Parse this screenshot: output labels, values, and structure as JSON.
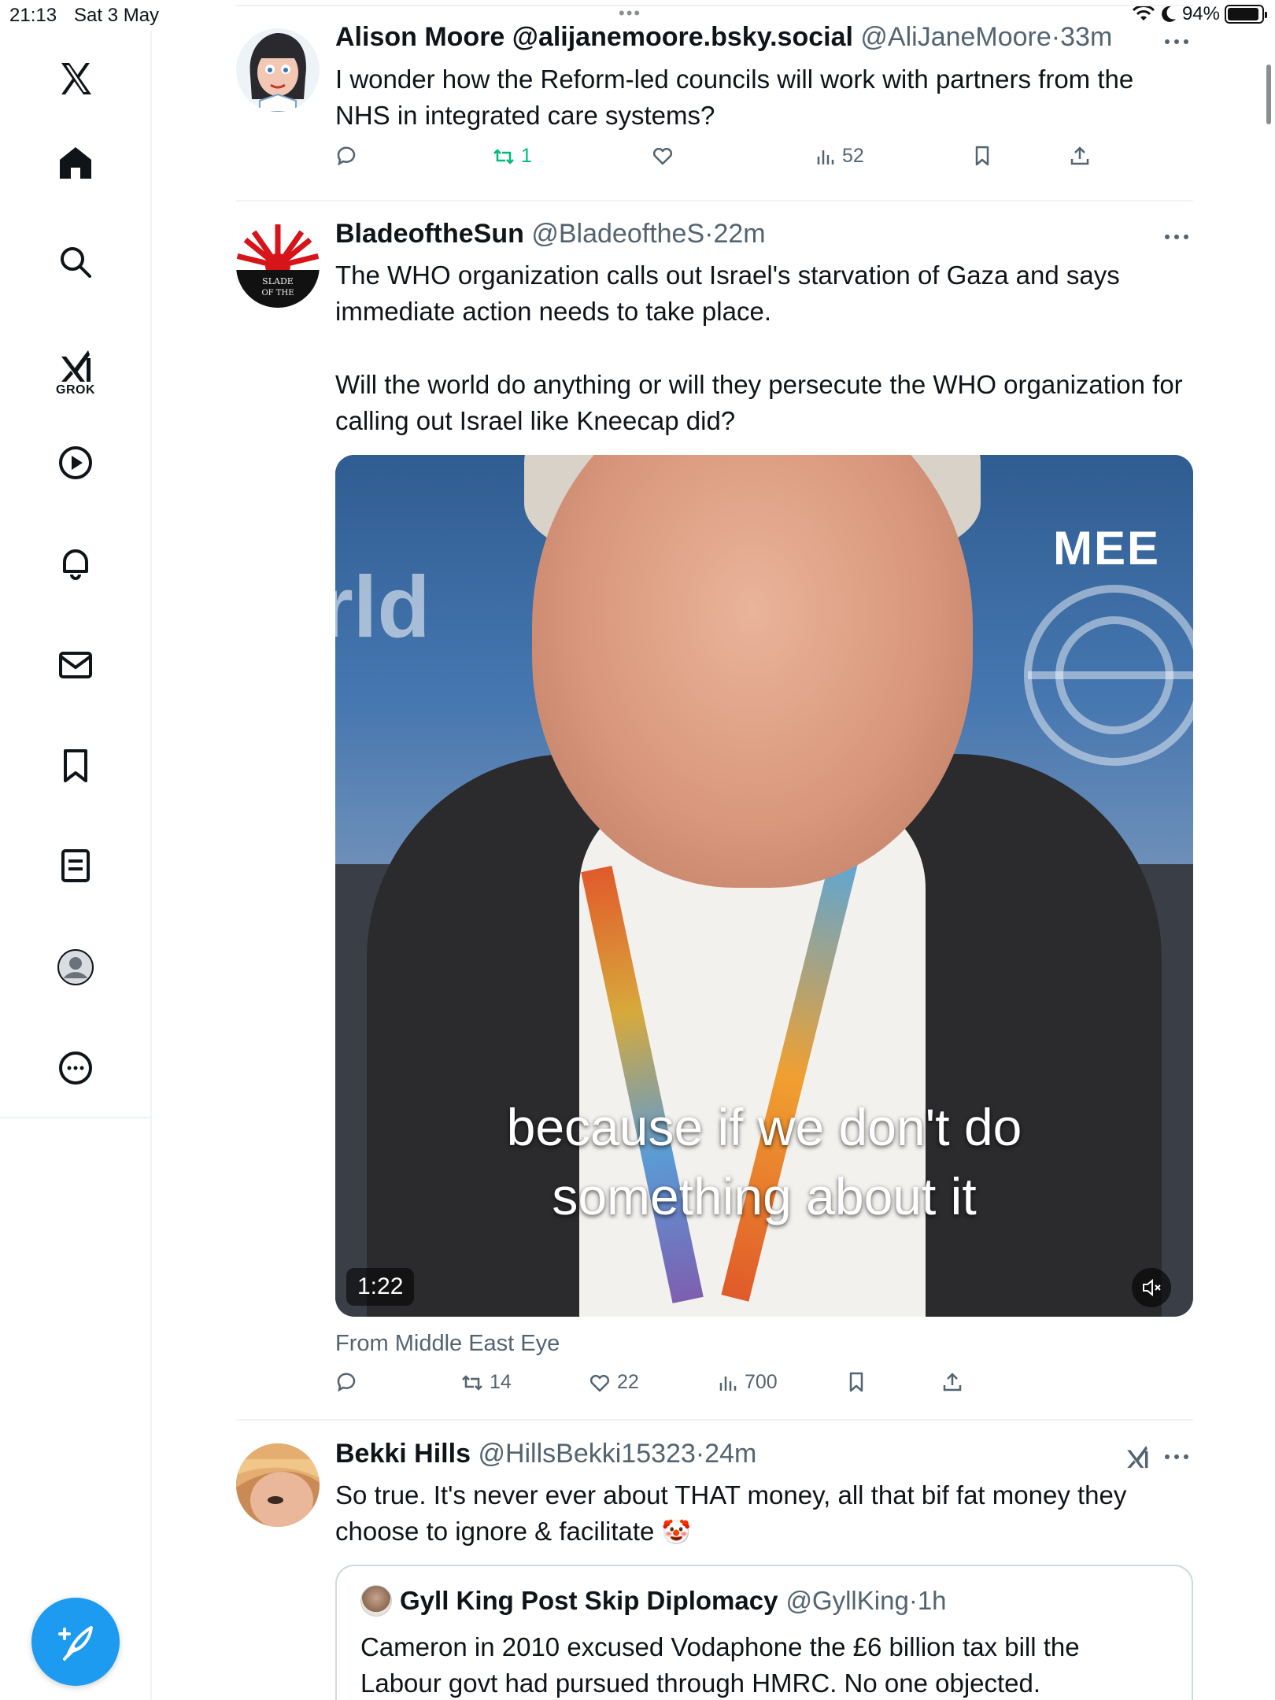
{
  "status_bar": {
    "time": "21:13",
    "date": "Sat 3 May",
    "dots": "•••",
    "battery": "94%",
    "battery_level": 0.94
  },
  "sidebar": {
    "items": [
      {
        "name": "x-logo",
        "icon": "x-logo-icon"
      },
      {
        "name": "home",
        "icon": "home-icon"
      },
      {
        "name": "search",
        "icon": "search-icon"
      },
      {
        "name": "grok",
        "icon": "grok-icon",
        "label": "GROK"
      },
      {
        "name": "video",
        "icon": "play-icon"
      },
      {
        "name": "notifications",
        "icon": "bell-icon"
      },
      {
        "name": "messages",
        "icon": "mail-icon"
      },
      {
        "name": "bookmarks",
        "icon": "bookmark-icon"
      },
      {
        "name": "lists",
        "icon": "list-icon"
      },
      {
        "name": "profile",
        "icon": "avatar-icon"
      },
      {
        "name": "more",
        "icon": "more-circle-icon"
      }
    ],
    "compose_icon": "compose-feather-icon"
  },
  "tweets": [
    {
      "name": "Alison Moore @alijanemoore.bsky.social",
      "handle": "@AliJaneMoore",
      "time": "·33m",
      "text": "I wonder how the Reform-led councils will work with partners from the NHS in integrated care systems?",
      "retweets": "1",
      "views": "52"
    },
    {
      "name": "BladeoftheSun",
      "handle": "@BladeoftheS",
      "time": "·22m",
      "text_1": "The WHO organization calls out Israel's starvation of Gaza and says immediate action needs to take place.",
      "text_2": "Will the world do anything or will they persecute the WHO organization for calling out Israel like Kneecap did?",
      "video": {
        "bg_text": "rld",
        "logo": "MEE",
        "caption_1": "because if we don't do",
        "caption_2": "something about it",
        "duration": "1:22"
      },
      "from": "From Middle East Eye",
      "retweets": "14",
      "likes": "22",
      "views": "700"
    },
    {
      "name": "Bekki Hills",
      "handle": "@HillsBekki15323",
      "time": "·24m",
      "text_1": "So true. It's never ever about THAT money, all that bif fat money they",
      "text_2": "choose to ignore & facilitate",
      "emoji": "🤡",
      "quote": {
        "name": "Gyll King Post Skip Diplomacy",
        "handle": "@GyllKing",
        "time": "·1h",
        "text_1": "Cameron in 2010 excused Vodaphone the £6 billion tax bill the",
        "text_2": "Labour govt had pursued through HMRC. No one objected."
      }
    }
  ],
  "colors": {
    "accent": "#1d9bf0",
    "retweet_green": "#00ba7c",
    "secondary_text": "#536471"
  }
}
